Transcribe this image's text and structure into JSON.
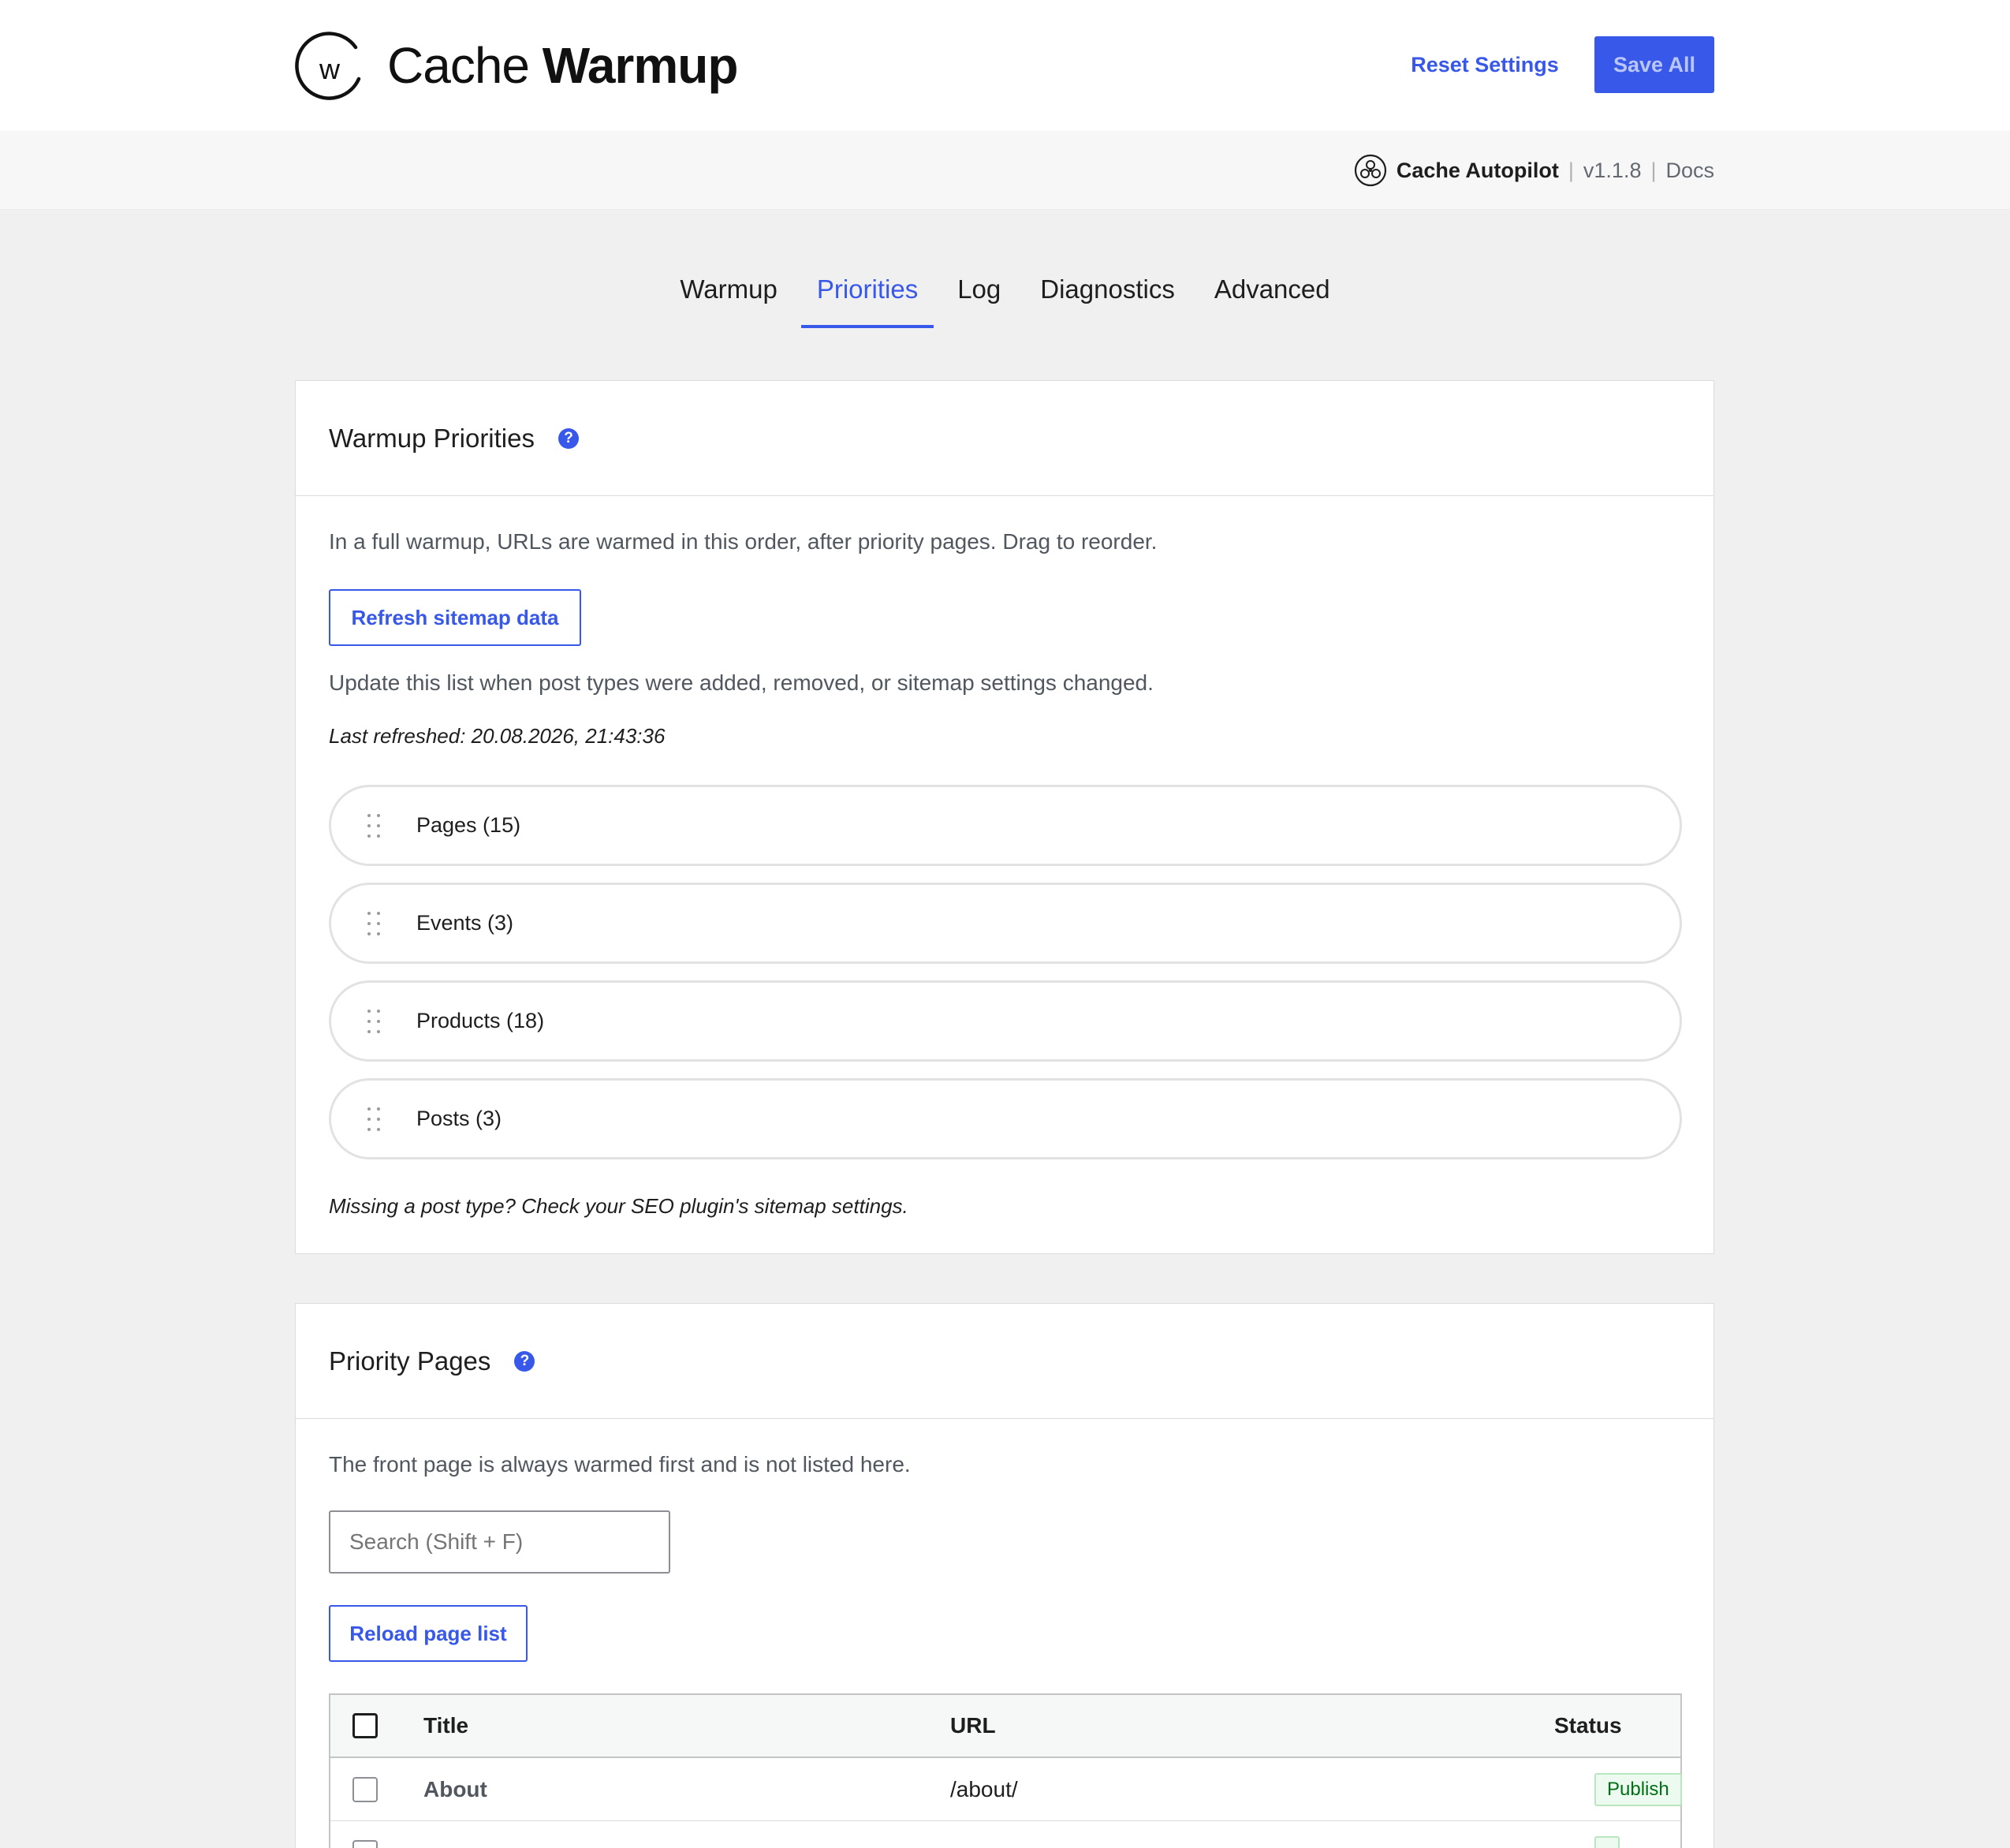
{
  "header": {
    "brand_light": "Cache",
    "brand_bold": "Warmup",
    "logo_letter": "w",
    "reset_label": "Reset Settings",
    "save_label": "Save All"
  },
  "subbar": {
    "product": "Cache Autopilot",
    "separator": "|",
    "version": "v1.1.8",
    "docs": "Docs"
  },
  "tabs": [
    {
      "label": "Warmup",
      "active": false
    },
    {
      "label": "Priorities",
      "active": true
    },
    {
      "label": "Log",
      "active": false
    },
    {
      "label": "Diagnostics",
      "active": false
    },
    {
      "label": "Advanced",
      "active": false
    }
  ],
  "warmup_priorities": {
    "title": "Warmup Priorities",
    "help": "?",
    "description": "In a full warmup, URLs are warmed in this order, after priority pages. Drag to reorder.",
    "refresh_label": "Refresh sitemap data",
    "refresh_hint": "Update this list when post types were added, removed, or sitemap settings changed.",
    "last_refreshed": "Last refreshed: 20.08.2026, 21:43:36",
    "post_types": [
      {
        "label": "Pages (15)"
      },
      {
        "label": "Events (3)"
      },
      {
        "label": "Products (18)"
      },
      {
        "label": "Posts (3)"
      }
    ],
    "missing_note": "Missing a post type? Check your SEO plugin's sitemap settings."
  },
  "priority_pages": {
    "title": "Priority Pages",
    "help": "?",
    "description": "The front page is always warmed first and is not listed here.",
    "search_placeholder": "Search (Shift + F)",
    "reload_label": "Reload page list",
    "columns": {
      "title": "Title",
      "url": "URL",
      "status": "Status"
    },
    "rows": [
      {
        "title": "About",
        "url": "/about/",
        "status": "Publish"
      },
      {
        "title": "",
        "url": "",
        "status": ""
      }
    ]
  },
  "colors": {
    "accent": "#3858e9",
    "status_publish": "#007017"
  }
}
